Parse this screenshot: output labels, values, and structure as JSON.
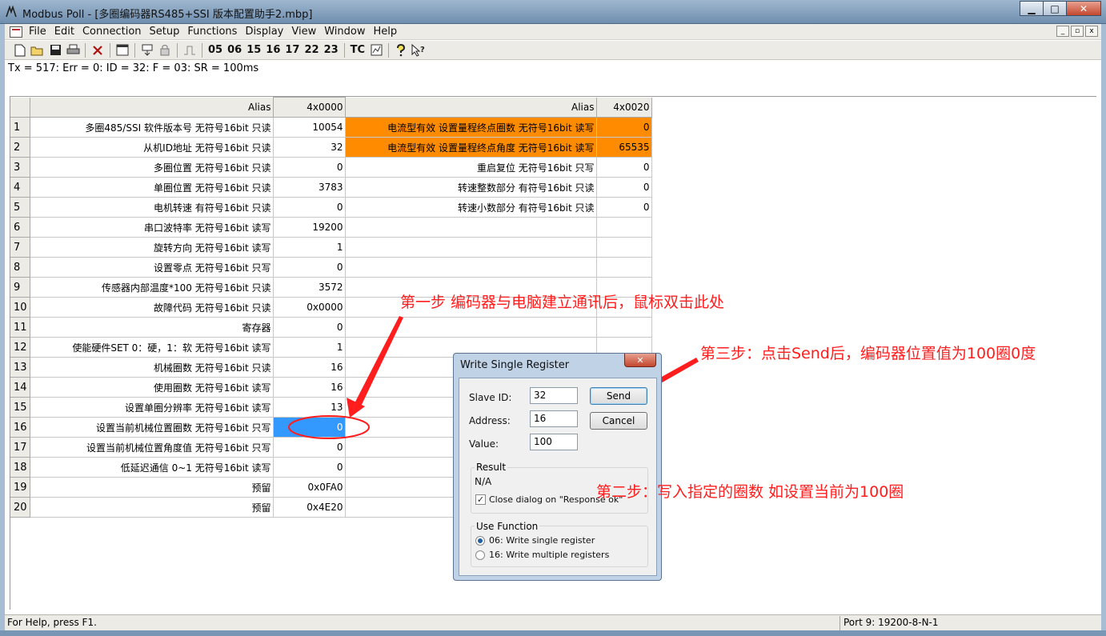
{
  "window": {
    "title": "Modbus Poll - [多圈编码器RS485+SSI 版本配置助手2.mbp]",
    "minimize": "▁",
    "maximize": "□",
    "close": "✕"
  },
  "menu": [
    "File",
    "Edit",
    "Connection",
    "Setup",
    "Functions",
    "Display",
    "View",
    "Window",
    "Help"
  ],
  "mdi_controls": [
    "_",
    "▫",
    "x"
  ],
  "toolbar": {
    "function_codes": [
      "05",
      "06",
      "15",
      "16",
      "17",
      "22",
      "23"
    ],
    "tc": "TC"
  },
  "status_line": "Tx = 517: Err = 0: ID = 32: F = 03: SR = 100ms",
  "grid": {
    "headers": [
      "Alias",
      "4x0000",
      "Alias",
      "4x0020"
    ],
    "rows": [
      {
        "n": "1",
        "alias1": "多圈485/SSI  软件版本号 无符号16bit 只读",
        "val1": "10054",
        "alias2": "电流型有效 设置量程终点圈数 无符号16bit 读写",
        "val2": "0"
      },
      {
        "n": "2",
        "alias1": "从机ID地址 无符号16bit 只读",
        "val1": "32",
        "alias2": "电流型有效 设置量程终点角度 无符号16bit 读写",
        "val2": "65535"
      },
      {
        "n": "3",
        "alias1": "多圈位置 无符号16bit 只读",
        "val1": "0",
        "alias2": "重启复位 无符号16bit 只写",
        "val2": "0"
      },
      {
        "n": "4",
        "alias1": "单圈位置 无符号16bit 只读",
        "val1": "3783",
        "alias2": "转速整数部分 有符号16bit 只读",
        "val2": "0"
      },
      {
        "n": "5",
        "alias1": "电机转速 有符号16bit 只读",
        "val1": "0",
        "alias2": "转速小数部分 有符号16bit 只读",
        "val2": "0"
      },
      {
        "n": "6",
        "alias1": "串口波特率 无符号16bit 读写",
        "val1": "19200",
        "alias2": "",
        "val2": ""
      },
      {
        "n": "7",
        "alias1": "旋转方向 无符号16bit 读写",
        "val1": "1",
        "alias2": "",
        "val2": ""
      },
      {
        "n": "8",
        "alias1": "设置零点 无符号16bit 只写",
        "val1": "0",
        "alias2": "",
        "val2": ""
      },
      {
        "n": "9",
        "alias1": "传感器内部温度*100 无符号16bit 只读",
        "val1": "3572",
        "alias2": "",
        "val2": ""
      },
      {
        "n": "10",
        "alias1": "故障代码 无符号16bit 只读",
        "val1": "0x0000",
        "alias2": "",
        "val2": ""
      },
      {
        "n": "11",
        "alias1": "寄存器",
        "val1": "0",
        "alias2": "",
        "val2": ""
      },
      {
        "n": "12",
        "alias1": "使能硬件SET 0：硬，1：软 无符号16bit 读写",
        "val1": "1",
        "alias2": "",
        "val2": ""
      },
      {
        "n": "13",
        "alias1": "机械圈数 无符号16bit 只读",
        "val1": "16",
        "alias2": "",
        "val2": ""
      },
      {
        "n": "14",
        "alias1": "使用圈数 无符号16bit 读写",
        "val1": "16",
        "alias2": "",
        "val2": ""
      },
      {
        "n": "15",
        "alias1": "设置单圈分辨率 无符号16bit 读写",
        "val1": "13",
        "alias2": "",
        "val2": ""
      },
      {
        "n": "16",
        "alias1": "设置当前机械位置圈数 无符号16bit 只写",
        "val1": "0",
        "alias2": "",
        "val2": ""
      },
      {
        "n": "17",
        "alias1": "设置当前机械位置角度值 无符号16bit 只写",
        "val1": "0",
        "alias2": "",
        "val2": ""
      },
      {
        "n": "18",
        "alias1": "低延迟通信 0~1 无符号16bit 读写",
        "val1": "0",
        "alias2": "",
        "val2": ""
      },
      {
        "n": "19",
        "alias1": "预留",
        "val1": "0x0FA0",
        "alias2": "",
        "val2": ""
      },
      {
        "n": "20",
        "alias1": "预留",
        "val1": "0x4E20",
        "alias2": "",
        "val2": ""
      }
    ]
  },
  "dialog": {
    "title": "Write Single Register",
    "close": "✕",
    "slave_id_label": "Slave ID:",
    "slave_id": "32",
    "address_label": "Address:",
    "address": "16",
    "value_label": "Value:",
    "value": "100",
    "send": "Send",
    "cancel": "Cancel",
    "result_label": "Result",
    "result_value": "N/A",
    "close_dialog_label": "Close dialog on \"Response ok\"",
    "use_function_label": "Use Function",
    "opt_06": "06: Write single register",
    "opt_16": "16: Write multiple registers"
  },
  "annotations": {
    "step1": "第一步 编码器与电脑建立通讯后，鼠标双击此处",
    "step2": "第二步：写入指定的圈数 如设置当前为100圈",
    "step3": "第三步：点击Send后，编码器位置值为100圈0度",
    "color": "#ff1d1d"
  },
  "statusbar": {
    "help": "For Help, press F1.",
    "port": "Port 9: 19200-8-N-1"
  },
  "colors": {
    "orange_highlight": "#ff8c00",
    "selection": "#3399ff"
  }
}
